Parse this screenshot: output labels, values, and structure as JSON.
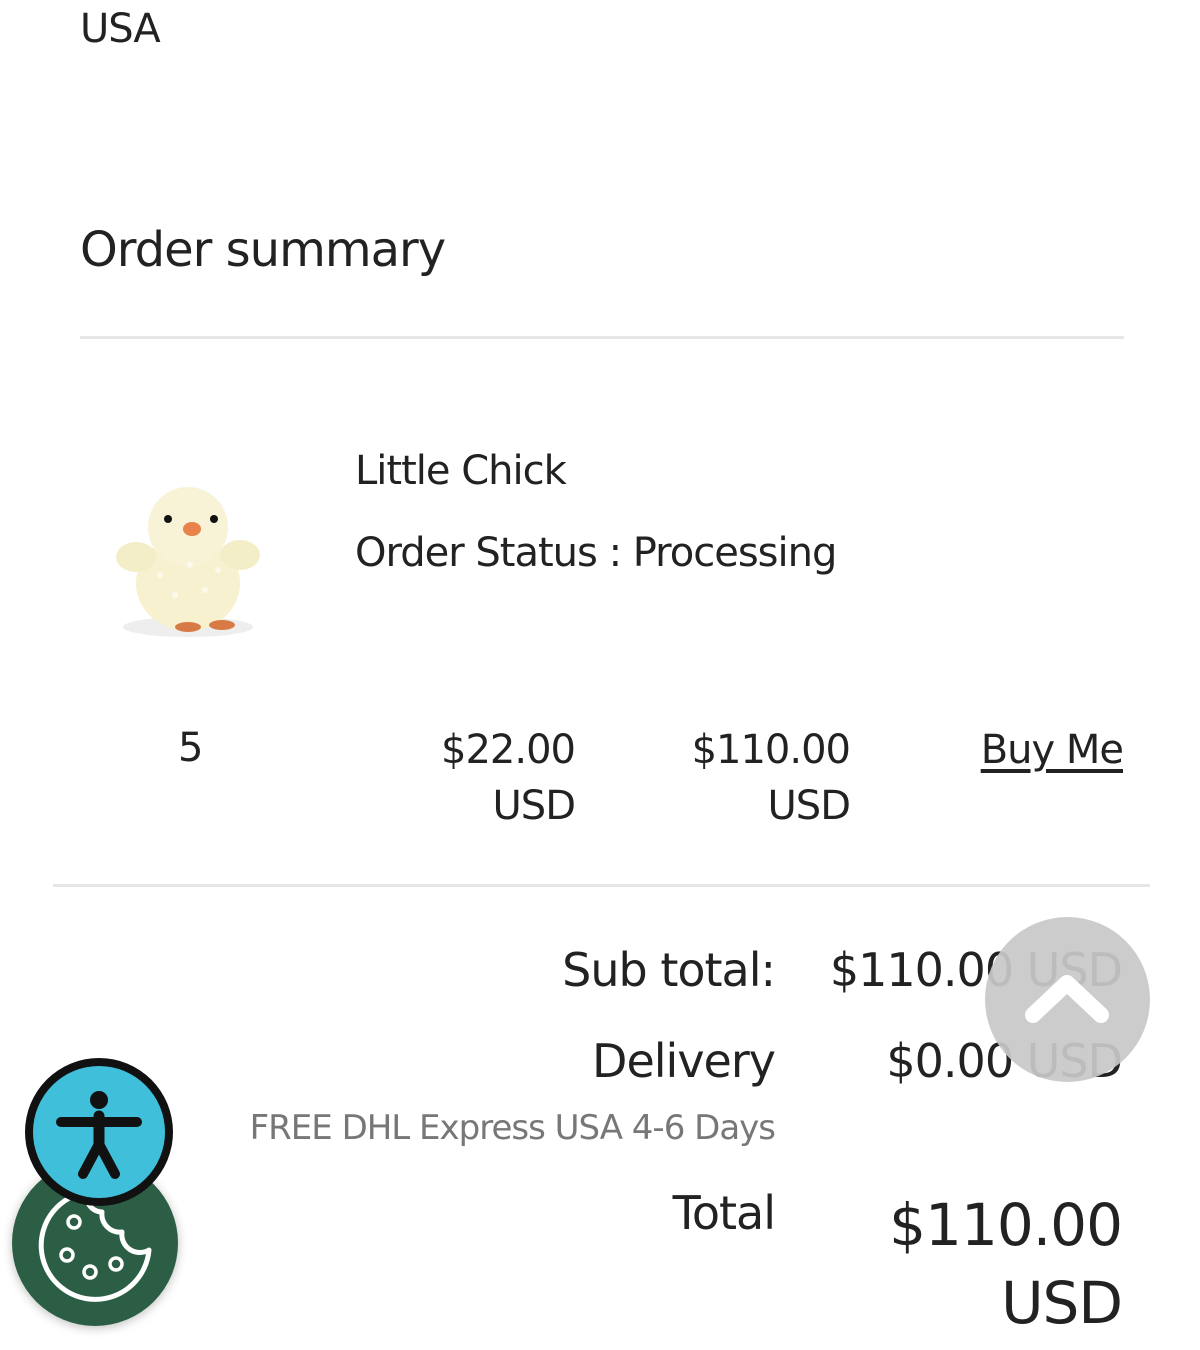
{
  "address": {
    "country": "USA"
  },
  "order_summary": {
    "title": "Order summary",
    "item": {
      "name": "Little Chick",
      "status_label": "Order Status : Processing",
      "image_alt": "Little Chick plush toy",
      "quantity": "5",
      "unit_price_amount": "$22.00",
      "unit_price_currency": "USD",
      "line_total_amount": "$110.00",
      "line_total_currency": "USD",
      "buy_link_label": "Buy Me"
    },
    "totals": {
      "subtotal_label": "Sub total:",
      "subtotal_value": "$110.00 USD",
      "delivery_label": "Delivery",
      "delivery_value": "$0.00 USD",
      "delivery_method": "FREE DHL Express USA 4-6 Days",
      "total_label": "Total",
      "total_amount": "$110.00",
      "total_currency": "USD"
    }
  },
  "floating_buttons": {
    "scroll_top_icon": "chevron-up-icon",
    "accessibility_icon": "accessibility-person-icon",
    "cookie_icon": "cookie-icon"
  },
  "colors": {
    "text": "#222222",
    "muted_text": "#777777",
    "divider": "#e6e6e6",
    "scroll_button_bg": "#c8c8c8",
    "accessibility_bg": "#3fbfd9",
    "cookie_bg": "#2b5e45"
  }
}
